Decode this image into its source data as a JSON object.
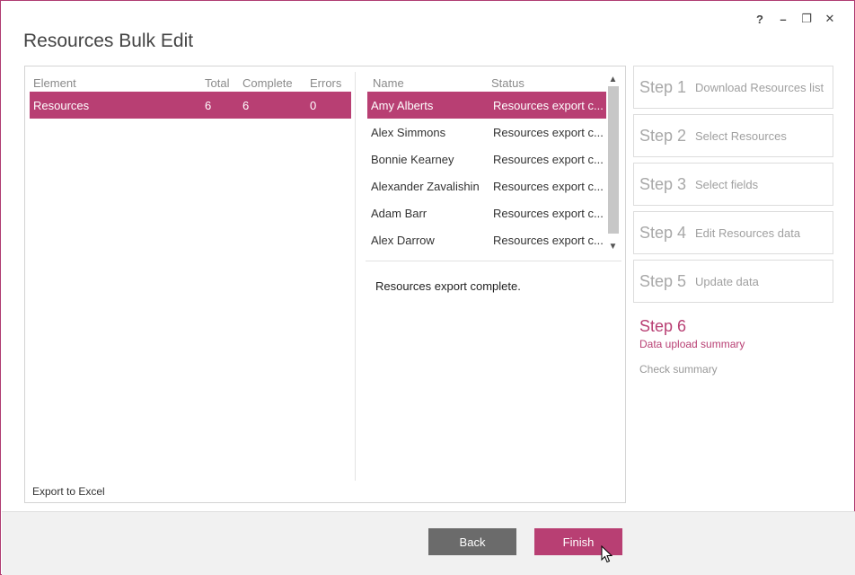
{
  "window": {
    "title": "Resources Bulk Edit",
    "controls": {
      "help": "?",
      "minimize": "–",
      "restore": "❐",
      "close": "✕"
    }
  },
  "left_grid": {
    "columns": [
      "Element",
      "Total",
      "Complete",
      "Errors"
    ],
    "rows": [
      {
        "element": "Resources",
        "total": "6",
        "complete": "6",
        "errors": "0"
      }
    ]
  },
  "right_grid": {
    "columns": [
      "Name",
      "Status"
    ],
    "rows": [
      {
        "name": "Amy Alberts",
        "status": "Resources export c..."
      },
      {
        "name": "Alex Simmons",
        "status": "Resources export c..."
      },
      {
        "name": "Bonnie Kearney",
        "status": "Resources export c..."
      },
      {
        "name": "Alexander Zavalishin",
        "status": "Resources export c..."
      },
      {
        "name": "Adam Barr",
        "status": "Resources export c..."
      },
      {
        "name": "Alex Darrow",
        "status": "Resources export c..."
      }
    ]
  },
  "message": "Resources export complete.",
  "export_link": "Export to Excel",
  "steps": [
    {
      "num": "Step 1",
      "label": "Download Resources list"
    },
    {
      "num": "Step 2",
      "label": "Select Resources"
    },
    {
      "num": "Step 3",
      "label": "Select fields"
    },
    {
      "num": "Step 4",
      "label": "Edit Resources data"
    },
    {
      "num": "Step 5",
      "label": "Update data"
    }
  ],
  "current_step": {
    "num": "Step 6",
    "label": "Data upload summary",
    "substep": "Check summary"
  },
  "buttons": {
    "back": "Back",
    "finish": "Finish"
  },
  "colors": {
    "accent": "#b83f73",
    "back_button": "#6b6b6b"
  }
}
